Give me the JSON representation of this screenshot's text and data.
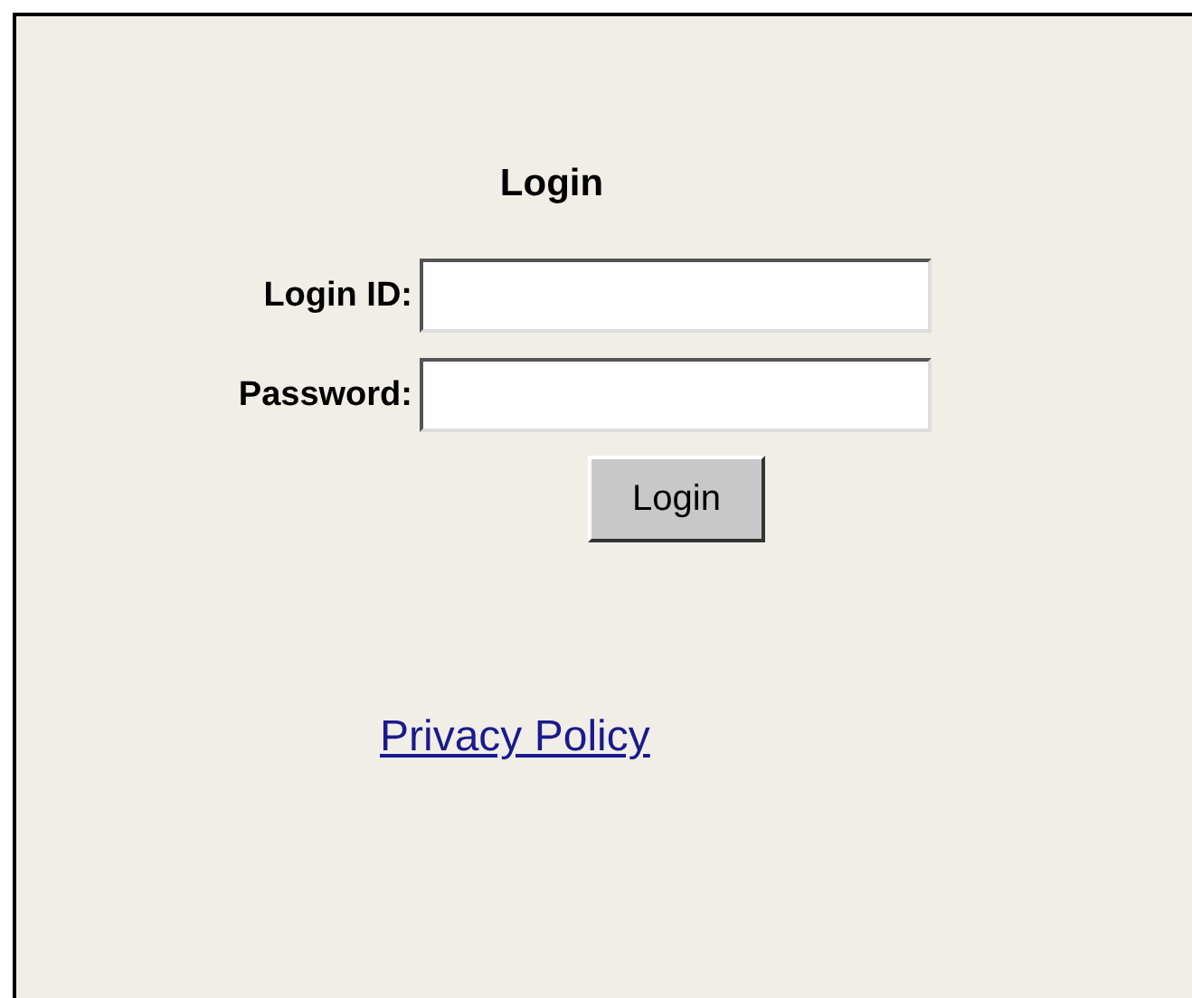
{
  "title": "Login",
  "fields": [
    {
      "label": "Login ID:"
    },
    {
      "label": "Password:"
    }
  ],
  "button": "Login",
  "link": "Privacy Policy"
}
